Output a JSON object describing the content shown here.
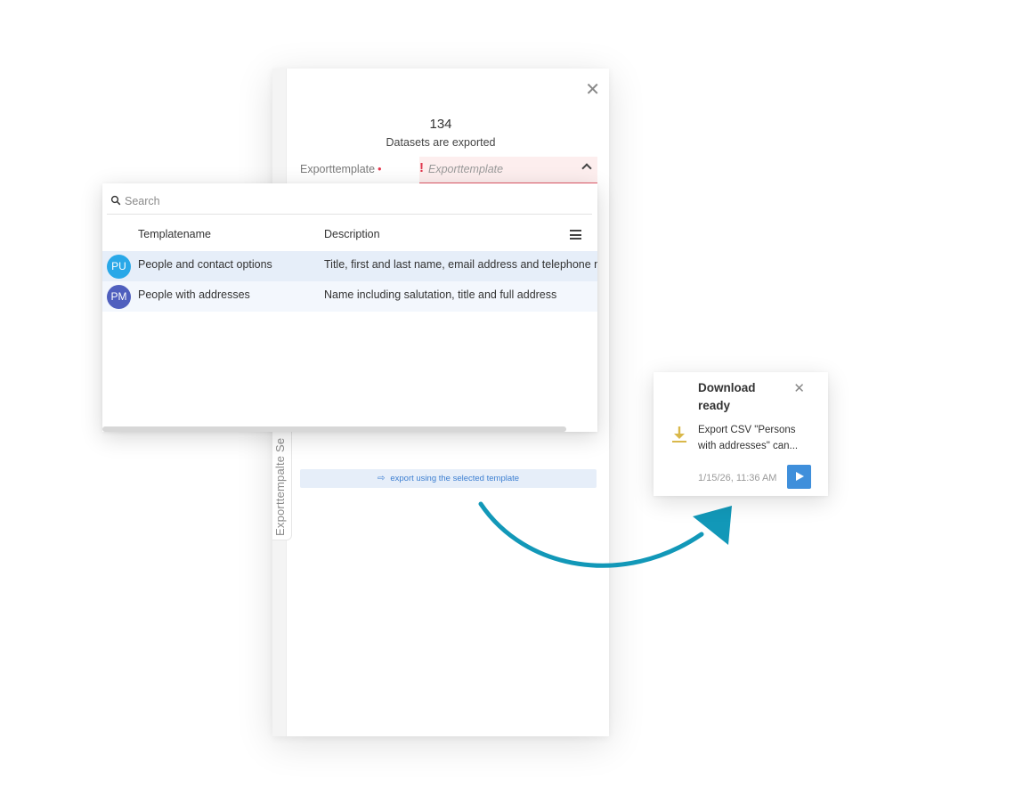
{
  "export_panel": {
    "count": "134",
    "count_caption": "Datasets are exported",
    "field_label": "Exporttemplate",
    "required_marker": "•",
    "select_error_mark": "!",
    "select_placeholder": "Exporttemplate",
    "close_glyph": "✕",
    "side_tab_label": "Exporttempalte Se",
    "export_button_label": "export using the selected template"
  },
  "dropdown": {
    "search_placeholder": "Search",
    "columns": {
      "name": "Templatename",
      "description": "Description"
    },
    "rows": [
      {
        "initials": "PU",
        "name": "People and contact options",
        "description": "Title, first and last name, email address and telephone n",
        "avatar_color": "#29a8e8"
      },
      {
        "initials": "PM",
        "name": "People with addresses",
        "description": "Name including salutation, title and full address",
        "avatar_color": "#4f5fbe"
      }
    ]
  },
  "notification": {
    "title": "Download ready",
    "message": "Export CSV \"Persons with addresses\" can...",
    "timestamp": "1/15/26, 11:36 AM",
    "close_glyph": "✕",
    "download_icon_color": "#d9b84a",
    "play_button_color": "#3f8fdb"
  },
  "colors": {
    "arrow": "#1298b8",
    "error": "#e0344c",
    "selected_row": "#e6eef9"
  }
}
